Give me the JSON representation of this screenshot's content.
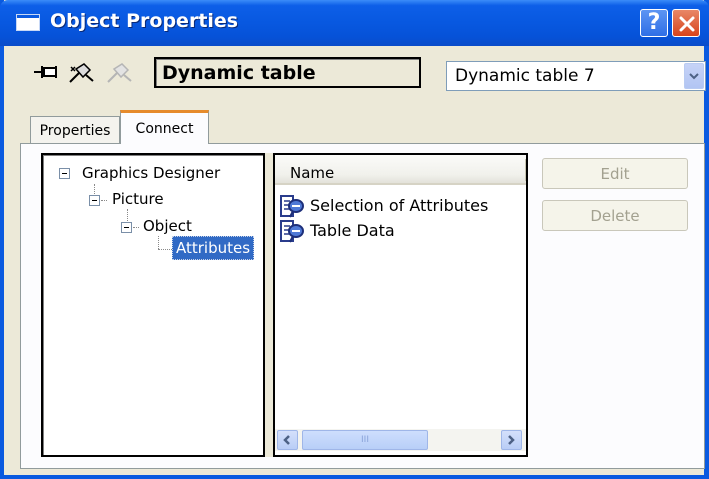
{
  "window": {
    "title": "Object Properties",
    "help_label": "?"
  },
  "toolbar": {
    "icons": [
      "pin-icon",
      "connect-icon",
      "disconnect-icon"
    ],
    "object_type": "Dynamic table",
    "object_select": {
      "value": "Dynamic table 7"
    }
  },
  "tabs": [
    {
      "label": "Properties",
      "active": false
    },
    {
      "label": "Connect",
      "active": true
    }
  ],
  "tree": {
    "nodes": [
      {
        "label": "Graphics Designer",
        "level": 0
      },
      {
        "label": "Picture",
        "level": 1
      },
      {
        "label": "Object",
        "level": 2
      },
      {
        "label": "Attributes",
        "level": 3,
        "selected": true
      }
    ]
  },
  "list": {
    "header": "Name",
    "items": [
      {
        "label": "Selection of Attributes",
        "icon": "script-icon"
      },
      {
        "label": "Table Data",
        "icon": "script-icon"
      }
    ],
    "scrollbar_grip": "III"
  },
  "buttons": {
    "edit": "Edit",
    "delete": "Delete"
  },
  "colors": {
    "titlebar": "#0858e0",
    "selection": "#316ac5",
    "active_tab_accent": "#e68b2c"
  }
}
